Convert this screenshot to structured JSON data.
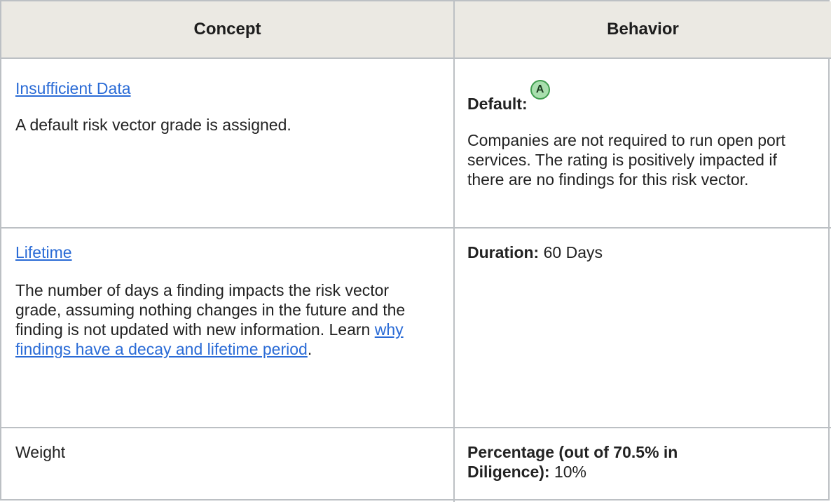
{
  "header": {
    "concept": "Concept",
    "behavior": "Behavior"
  },
  "rows": [
    {
      "concept_link": "Insufficient Data",
      "concept_text": "A default risk vector grade is assigned.",
      "behavior_label": "Default:",
      "behavior_badge": "A",
      "behavior_text": "Companies are not required to run open port services. The rating is positively impacted if there are no findings for this risk vector."
    },
    {
      "concept_link": "Lifetime",
      "concept_text": "The number of days a finding impacts the risk vector grade, assuming nothing changes in the future and the finding is not updated with new information. Learn",
      "concept_inline_link": "why findings have a decay and lifetime period",
      "concept_text_end": ".",
      "behavior_label": "Duration:",
      "behavior_value": " 60 Days"
    },
    {
      "concept_text": "Weight",
      "behavior_label": "Percentage (out of 70.5% in Diligence):",
      "behavior_value": " 10%"
    }
  ],
  "colors": {
    "header_bg": "#ebe9e3",
    "border": "#bcc0c4",
    "link": "#2a6bd6",
    "badge_fill": "#a9dfae",
    "badge_border": "#3f9d4e"
  }
}
